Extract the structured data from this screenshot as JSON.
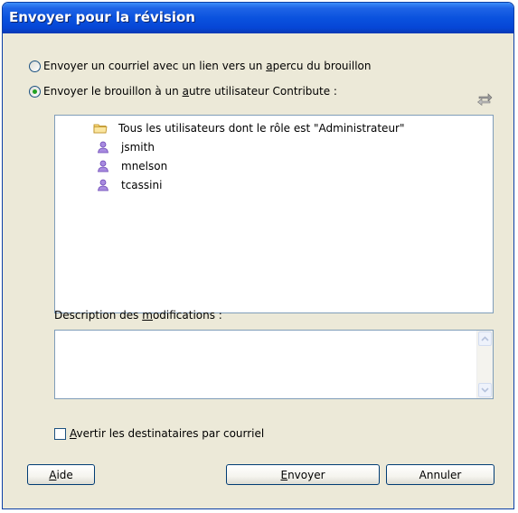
{
  "dialog": {
    "title": "Envoyer pour la révision"
  },
  "options": {
    "email_link": {
      "text_before": "Envoyer un courriel avec un lien vers un ",
      "mnemonic": "a",
      "text_after": "percu du brouillon",
      "selected": false
    },
    "send_user": {
      "text_before": "Envoyer le brouillon à un ",
      "mnemonic": "a",
      "text_after": "utre utilisateur Contribute :",
      "selected": true
    }
  },
  "recipients": [
    {
      "label": "Tous les utilisateurs dont le rôle est \"Administrateur\"",
      "icon": "folder-icon"
    },
    {
      "label": "jsmith",
      "icon": "user-icon"
    },
    {
      "label": "mnelson",
      "icon": "user-icon"
    },
    {
      "label": "tcassini",
      "icon": "user-icon"
    }
  ],
  "description": {
    "label_before": "Description des ",
    "label_mnemonic": "m",
    "label_after": "odifications :",
    "value": ""
  },
  "notify": {
    "mnemonic": "A",
    "label_after": "vertir les destinataires par courriel",
    "checked": false
  },
  "buttons": {
    "help_mnemonic": "A",
    "help_rest": "ide",
    "send_mnemonic": "E",
    "send_rest": "nvoyer",
    "cancel": "Annuler"
  },
  "colors": {
    "title_bar": "#0a52de",
    "dialog_bg": "#ece9d8",
    "radio_dot": "#21a121",
    "user_icon": "#8b5fc8",
    "folder_icon": "#f0c85a"
  }
}
